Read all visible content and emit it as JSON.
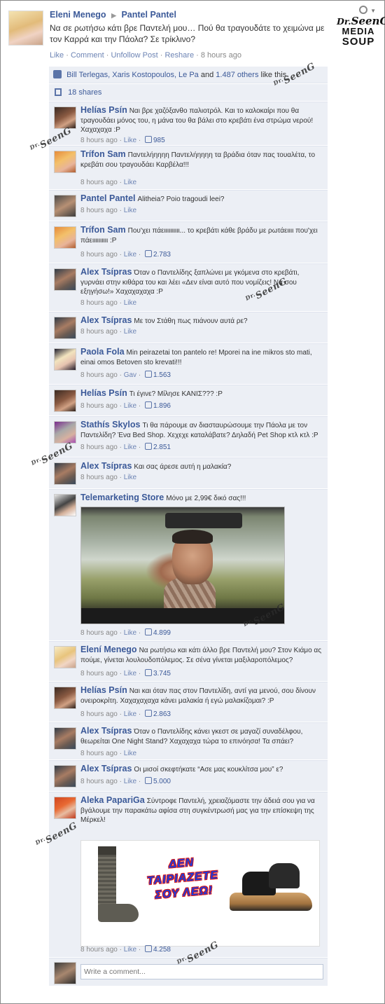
{
  "post": {
    "author": "Eleni Menego",
    "target": "Pantel Pantel",
    "text": "Να σε ρωτήσω κάτι βρε Παντελή μου… Πού θα τραγουδάτε το χειμώνα με τον Καρρά και την Πάολα? Σε τρίκλινο?",
    "actions": [
      "Like",
      "Comment",
      "Unfollow Post",
      "Reshare"
    ],
    "time": "8 hours ago",
    "logo": {
      "line1": "SeenG",
      "line2": "MEDIA",
      "line3": "SOUP",
      "prefix": "Dr."
    }
  },
  "likes": {
    "names": "Bill Terlegas, Xaris Kostopoulos, Le Pa",
    "and": "and",
    "others": "1.487 others",
    "suffix": "like this"
  },
  "shares": "18 shares",
  "watermark": {
    "prefix": "Dr.",
    "text": "SeenG"
  },
  "meta_labels": {
    "time": "8 hours ago",
    "like": "Like",
    "gav": "Gav"
  },
  "comments": [
    {
      "name": "Helías Psín",
      "text": "Ναι βρε χαζόξανθο παλιοτρόλ. Και το καλοκαίρι που θα τραγουδάει μόνος του, η μάνα του θα βάλει στο κρεβάτι ένα στρώμα νερού! Χαχαχαχα :P",
      "likes": "985"
    },
    {
      "name": "Trífon Sam",
      "text": "Παντελήηηηη Παντελήηηηη τα βράδια όταν πας τουαλέτα, το κρεβάτι σου τραγουδάει Καρβέλα!!!",
      "likes": ""
    },
    {
      "name": "Pantel Pantel",
      "text": "Alitheia? Poio tragoudi leei?",
      "likes": ""
    },
    {
      "name": "Trífon Sam",
      "text": "Που'χει πάειιιιιιιιιι... το κρεβάτι κάθε βράδυ με ρωτάειιιι που'χει πάειιιιιιιιιι :P",
      "likes": "2.783"
    },
    {
      "name": "Alex Tsípras",
      "text": "Όταν ο Παντελίδης ξαπλώνει με γκόμενα στο κρεβάτι, γυρνάει στην κιθάρα του και λέει «Δεν είναι αυτό που νομίζεις! Να σου εξηγήσω!» Χαχαχαχαχα :P",
      "likes": ""
    },
    {
      "name": "Alex Tsípras",
      "text": "Με τον Στάθη πως πιάνουν αυτά ρε?",
      "likes": ""
    },
    {
      "name": "Paola Fola",
      "text": "Min peirazetai ton pantelo re! Mporei na ine mikros sto mati, einai omos Betoven sto krevati!!!",
      "likes": "1.563"
    },
    {
      "name": "Helías Psín",
      "text": "Τι έγινε? Μίλησε ΚΑΝΙΣ??? :P",
      "likes": "1.896"
    },
    {
      "name": "Stathís Skylos",
      "text": "Τι θα πάρουμε αν διασταυρώσουμε την Πάολα με τον Παντελίδη? Ένα Bed Shop. Χεχεχε καταλάβατε? Δηλαδή Pet Shop κτλ κτλ :P",
      "likes": "2.851"
    },
    {
      "name": "Alex Tsípras",
      "text": "Και σας άρεσε αυτή η μαλακία?",
      "likes": ""
    },
    {
      "name": "Telemarketing Store",
      "text": "Μόνο με 2,99€ δικό σας!!!",
      "likes": "4.899"
    },
    {
      "name": "Elení Menego",
      "text": "Να ρωτήσω και κάτι άλλο βρε Παντελή μου? Στον Κιάμο ας πούμε, γίνεται λουλουδοπόλεμος. Σε σένα γίνεται μαξιλαροπόλεμος?",
      "likes": "3.745"
    },
    {
      "name": "Helías Psín",
      "text": "Ναι και όταν πας στον Παντελίδη, αντί για μενού, σου δίνουν ονειροκρίτη. Χαχαχαχαχα κάνει μαλακία ή εγώ μαλακίζομαι? :P",
      "likes": "2.863"
    },
    {
      "name": "Alex Tsípras",
      "text": "Όταν ο Παντελίδης κάνει γκεστ σε μαγαζί συναδέλφου, θεωρείται One Night Stand? Χαχαχαχα τώρα το επινόησα! Τα σπάει?",
      "likes": ""
    },
    {
      "name": "Alex Tsípras",
      "text": "Οι μισοί σκεφτήκατε “Ασε μας κουκλίτσα μου” ε?",
      "likes": "5.000"
    },
    {
      "name": "Aleka PapariGa",
      "text": "Σύντροφε Παντελή, χρειαζόμαστε την άδειά σου για να βγάλουμε την παρακάτω αφίσα στη συγκέντρωσή μας για την επίσκεψη της Μέρκελ!",
      "likes": "4.258"
    }
  ],
  "ad_image": {
    "line1": "ΔΕΝ",
    "line2": "ΤΑΙΡΙΑΖΕΤΕ",
    "line3": "ΣΟΥ ΛΕΩ!"
  },
  "compose": {
    "placeholder": "Write a comment..."
  }
}
